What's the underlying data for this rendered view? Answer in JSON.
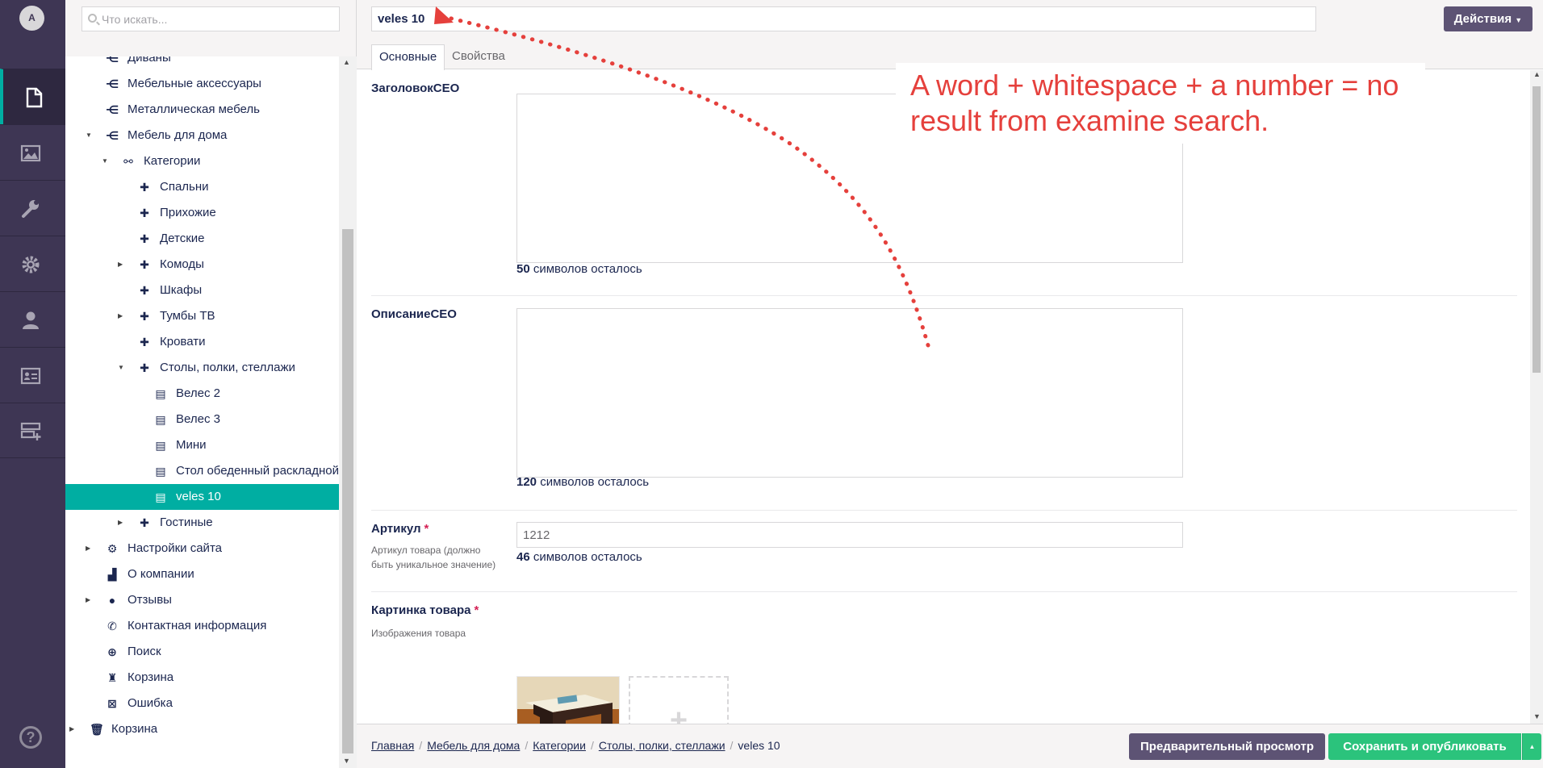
{
  "rail": {
    "avatar_initial": "A",
    "sections": [
      {
        "icon": "content-document-icon",
        "active": true
      },
      {
        "icon": "media-image-icon",
        "active": false
      },
      {
        "icon": "wrench-settings-icon",
        "active": false
      },
      {
        "icon": "gear-icon",
        "active": false
      },
      {
        "icon": "user-icon",
        "active": false
      },
      {
        "icon": "member-card-icon",
        "active": false
      },
      {
        "icon": "forms-icon",
        "active": false
      }
    ],
    "help_glyph": "?"
  },
  "tree": {
    "search_placeholder": "Что искать...",
    "items": [
      {
        "label": "Диваны",
        "icon": "tree-branch-icon"
      },
      {
        "label": "Мебельные аксессуары",
        "icon": "tree-branch-icon"
      },
      {
        "label": "Металлическая мебель",
        "icon": "tree-branch-icon"
      },
      {
        "label": "Мебель для дома",
        "icon": "tree-branch-icon",
        "expanded": true
      },
      {
        "label": "Категории",
        "icon": "categories-icon",
        "expanded": true
      },
      {
        "label": "Спальни",
        "icon": "category-cross-icon"
      },
      {
        "label": "Прихожие",
        "icon": "category-cross-icon"
      },
      {
        "label": "Детские",
        "icon": "category-cross-icon"
      },
      {
        "label": "Комоды",
        "icon": "category-cross-icon",
        "collapsed": true
      },
      {
        "label": "Шкафы",
        "icon": "category-cross-icon"
      },
      {
        "label": "Тумбы ТВ",
        "icon": "category-cross-icon",
        "collapsed": true
      },
      {
        "label": "Кровати",
        "icon": "category-cross-icon"
      },
      {
        "label": "Столы, полки, стеллажи",
        "icon": "category-cross-icon",
        "expanded": true
      },
      {
        "label": "Велес 2",
        "icon": "product-page-icon"
      },
      {
        "label": "Велес 3",
        "icon": "product-page-icon"
      },
      {
        "label": "Мини",
        "icon": "product-page-icon"
      },
      {
        "label": "Стол обеденный раскладной",
        "icon": "product-page-icon"
      },
      {
        "label": "veles 10",
        "icon": "product-page-icon",
        "selected": true
      },
      {
        "label": "Гостиные",
        "icon": "category-cross-icon",
        "collapsed": true
      },
      {
        "label": "Настройки сайта",
        "icon": "site-settings-icon",
        "collapsed": true
      },
      {
        "label": "О компании",
        "icon": "factory-icon"
      },
      {
        "label": "Отзывы",
        "icon": "speech-bubble-icon",
        "collapsed": true
      },
      {
        "label": "Контактная информация",
        "icon": "phone-icon"
      },
      {
        "label": "Поиск",
        "icon": "zoom-search-icon"
      },
      {
        "label": "Корзина",
        "icon": "cart-bin-icon"
      },
      {
        "label": "Ошибка",
        "icon": "error-box-icon"
      },
      {
        "label": "Корзина",
        "icon": "trash-icon",
        "collapsed": true
      }
    ]
  },
  "header": {
    "node_name": "veles 10",
    "actions_label": "Действия",
    "tabs": [
      {
        "label": "Основные",
        "active": true
      },
      {
        "label": "Свойства",
        "active": false
      }
    ]
  },
  "properties": {
    "seo_title": {
      "label": "ЗаголовокСЕО",
      "remaining": "50",
      "remaining_suffix": "символов осталось"
    },
    "seo_description": {
      "label": "ОписаниеСЕО",
      "remaining": "120",
      "remaining_suffix": "символов осталось"
    },
    "sku": {
      "label": "Артикул",
      "required_mark": "*",
      "description": "Артикул товара (должно быть уникальное значение)",
      "value": "1212",
      "remaining": "46",
      "remaining_suffix": "символов осталось"
    },
    "product_image": {
      "label": "Картинка товара",
      "required_mark": "*",
      "description": "Изображения товара",
      "add_glyph": "+"
    }
  },
  "annotation": {
    "text": "A word + whitespace + a number = no result from examine search.",
    "color": "#e5403c"
  },
  "footer": {
    "breadcrumb": [
      "Главная",
      "Мебель для дома",
      "Категории",
      "Столы, полки, стеллажи"
    ],
    "breadcrumb_current": "veles 10",
    "preview_label": "Предварительный просмотр",
    "publish_label": "Сохранить и опубликовать"
  },
  "colors": {
    "rail_bg": "#3e3654",
    "selected_bg": "#00aea2",
    "publish_green": "#2bc37c",
    "button_purple": "#5d5374"
  }
}
